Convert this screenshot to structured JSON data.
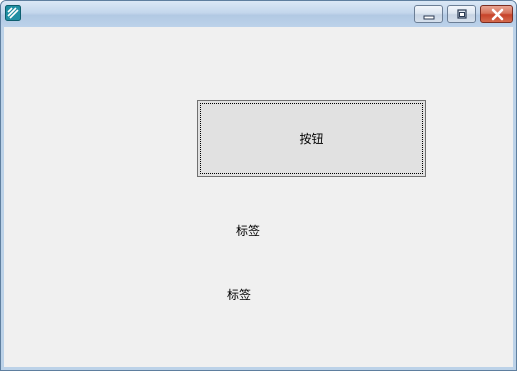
{
  "window": {
    "title": "",
    "controls": {
      "minimize_icon": "minimize-icon",
      "maximize_icon": "restore-icon",
      "close_icon": "close-icon"
    },
    "app_icon": "app-icon"
  },
  "content": {
    "button_label": "按钮",
    "label_1": "标签",
    "label_2": "标签"
  },
  "colors": {
    "client_background": "#f0f0f0",
    "button_face": "#e1e1e1",
    "close_button": "#c7432a",
    "titlebar": "#c4d7ec"
  }
}
